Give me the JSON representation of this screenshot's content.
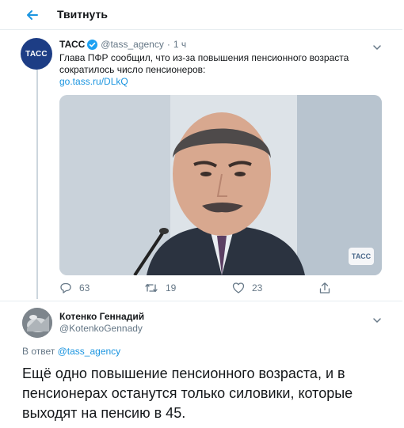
{
  "header": {
    "title": "Твитнуть",
    "back_icon": "arrow-left-icon"
  },
  "quoted_tweet": {
    "avatar_text": "ТАСС",
    "name": "ТАСС",
    "handle": "@tass_agency",
    "dot": "·",
    "time": "1 ч",
    "text": "Глава ПФР сообщил, что из-за повышения пенсионного возраста сократилось число пенсионеров:",
    "link": "go.tass.ru/DLkQ",
    "media_badge": "ТАСС",
    "reply_count": "63",
    "retweet_count": "19",
    "like_count": "23"
  },
  "reply_tweet": {
    "name": "Котенко Геннадий",
    "handle": "@KotenkoGennady",
    "replying_label": "В ответ",
    "replying_to": "@tass_agency",
    "text": "Ещё одно повышение пенсионного возраста, и в пенсионерах останутся только силовики, которые выходят на пенсию в 45."
  },
  "colors": {
    "accent": "#1b95e0",
    "secondary_text": "#657786",
    "primary_text": "#14171a",
    "verified": "#1da1f2",
    "avatar_bg": "#1d3d85"
  }
}
